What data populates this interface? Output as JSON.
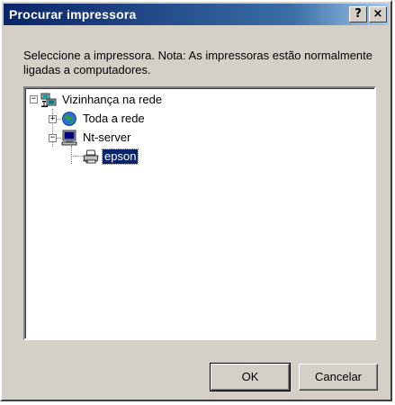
{
  "window": {
    "title": "Procurar impressora",
    "help_glyph": "?",
    "close_glyph": "×"
  },
  "instructions": "Seleccione a impressora. Nota: As impressoras estão normalmente ligadas a computadores.",
  "tree": {
    "nodes": [
      {
        "label": "Vizinhança na rede",
        "icon": "network-neighborhood-icon",
        "expanded": true,
        "expander": "−"
      },
      {
        "label": "Toda a rede",
        "icon": "globe-icon",
        "expanded": false,
        "expander": "+"
      },
      {
        "label": "Nt-server",
        "icon": "computer-icon",
        "expanded": true,
        "expander": "−"
      },
      {
        "label": "epson",
        "icon": "printer-icon",
        "selected": true
      }
    ]
  },
  "buttons": {
    "ok": "OK",
    "cancel": "Cancelar"
  },
  "colors": {
    "title_start": "#0a246a",
    "title_end": "#a6caf0",
    "selection": "#0a246a",
    "face": "#d4d0c8"
  }
}
